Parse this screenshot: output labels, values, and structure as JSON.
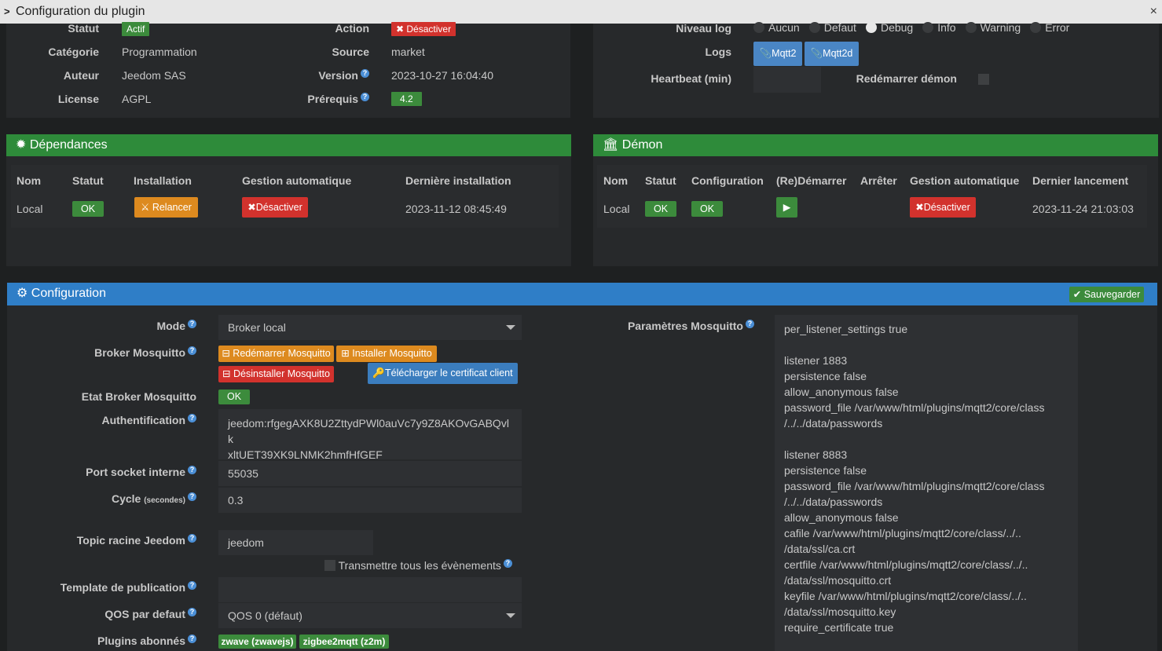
{
  "window": {
    "title": "Configuration du plugin"
  },
  "info": {
    "statut_label": "Statut",
    "statut_value": "Actif",
    "categorie_label": "Catégorie",
    "categorie_value": "Programmation",
    "auteur_label": "Auteur",
    "auteur_value": "Jeedom SAS",
    "license_label": "License",
    "license_value": "AGPL",
    "action_label": "Action",
    "action_button": "Désactiver",
    "source_label": "Source",
    "source_value": "market",
    "version_label": "Version",
    "version_value": "2023-10-27 16:04:40",
    "prerequis_label": "Prérequis",
    "prerequis_value": "4.2"
  },
  "logs": {
    "niveau_label": "Niveau log",
    "levels": [
      "Aucun",
      "Defaut",
      "Debug",
      "Info",
      "Warning",
      "Error"
    ],
    "selected": "Debug",
    "logs_label": "Logs",
    "log_buttons": [
      "Mqtt2",
      "Mqtt2d"
    ],
    "heartbeat_label": "Heartbeat (min)",
    "heartbeat_value": "",
    "restart_label": "Redémarrer démon"
  },
  "dependances": {
    "title": "Dépendances",
    "headers": [
      "Nom",
      "Statut",
      "Installation",
      "Gestion automatique",
      "Dernière installation"
    ],
    "row": {
      "nom": "Local",
      "statut": "OK",
      "installation": "Relancer",
      "gestion": "Désactiver",
      "derniere": "2023-11-12 08:45:49"
    }
  },
  "demon": {
    "title": "Démon",
    "headers": [
      "Nom",
      "Statut",
      "Configuration",
      "(Re)Démarrer",
      "Arrêter",
      "Gestion automatique",
      "Dernier lancement"
    ],
    "row": {
      "nom": "Local",
      "statut": "OK",
      "configuration": "OK",
      "gestion": "Désactiver",
      "dernier": "2023-11-24 21:03:03"
    }
  },
  "configuration": {
    "title": "Configuration",
    "save_button": "Sauvegarder",
    "mode_label": "Mode",
    "mode_value": "Broker local",
    "broker_label": "Broker Mosquitto",
    "btn_redemarrer": "Redémarrer Mosquitto",
    "btn_installer": "Installer Mosquitto",
    "btn_desinstaller": "Désinstaller Mosquitto",
    "btn_certificat": "Télécharger le certificat client",
    "etat_label": "Etat Broker Mosquitto",
    "etat_value": "OK",
    "auth_label": "Authentification",
    "auth_value": "jeedom:rfgegAXK8U2ZttydPWl0auVc7y9Z8AKOvGABQvlk\nxltUET39XK9LNMK2hmfHfGEF",
    "port_label": "Port socket interne",
    "port_value": "55035",
    "cycle_label": "Cycle",
    "cycle_unit": "(secondes)",
    "cycle_value": "0.3",
    "topic_label": "Topic racine Jeedom",
    "topic_value": "jeedom",
    "transmettre_label": "Transmettre tous les évènements",
    "template_label": "Template de publication",
    "template_value": "",
    "qos_label": "QOS par defaut",
    "qos_value": "QOS 0 (défaut)",
    "plugins_label": "Plugins abonnés",
    "plugins": [
      "zwave (zwavejs)",
      "zigbee2mqtt (z2m)"
    ],
    "params_label": "Paramètres Mosquitto",
    "params_value": "per_listener_settings true\n\nlistener 1883\npersistence false\nallow_anonymous false\npassword_file /var/www/html/plugins/mqtt2/core/class\n/../../data/passwords\n\nlistener 8883\npersistence false\npassword_file /var/www/html/plugins/mqtt2/core/class\n/../../data/passwords\nallow_anonymous false\ncafile /var/www/html/plugins/mqtt2/core/class/../..\n/data/ssl/ca.crt\ncertfile /var/www/html/plugins/mqtt2/core/class/../..\n/data/ssl/mosquitto.crt\nkeyfile /var/www/html/plugins/mqtt2/core/class/../..\n/data/ssl/mosquitto.key\nrequire_certificate true"
  }
}
